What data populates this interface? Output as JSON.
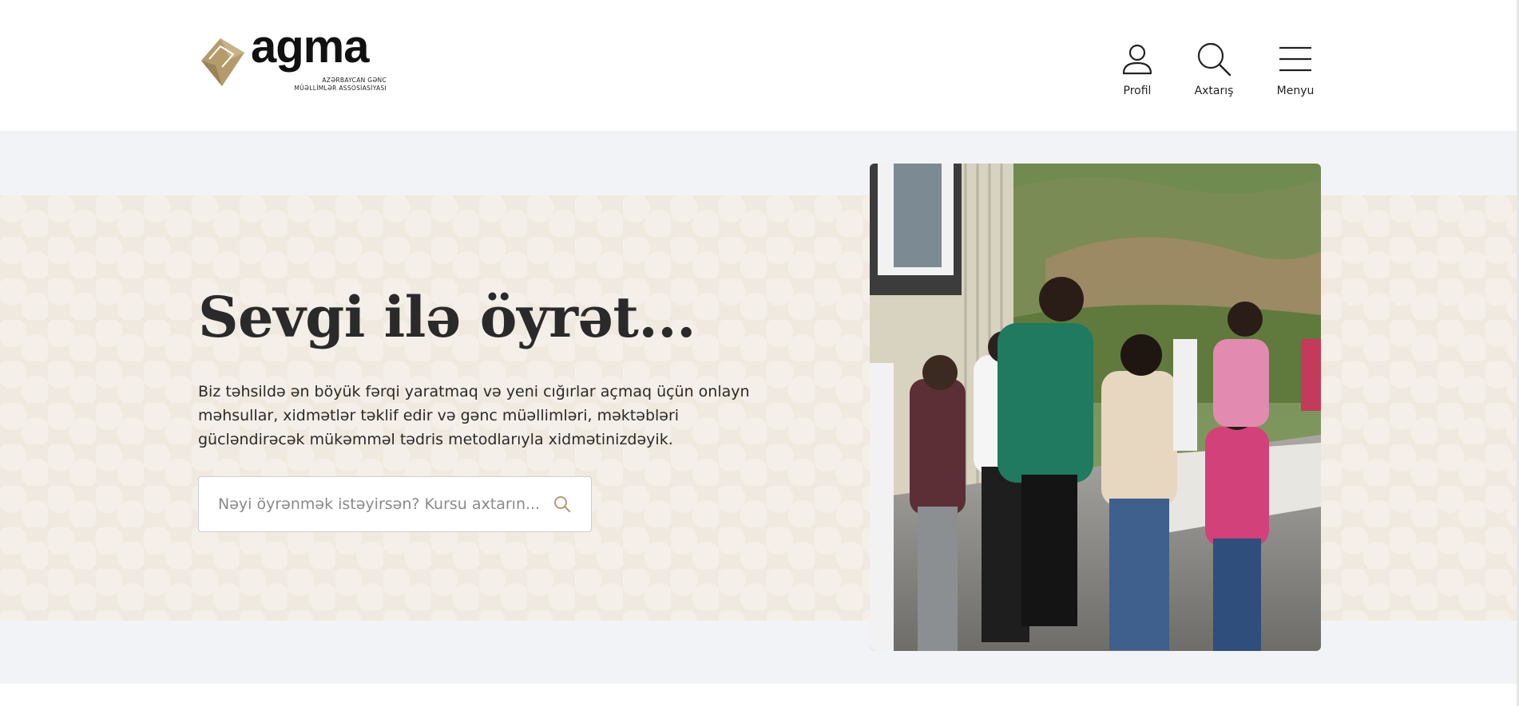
{
  "brand": {
    "logo_word": "agma",
    "logo_sub1": "AZƏRBAYCAN GƏNC",
    "logo_sub2": "MÜƏLLİMLƏR ASSOSİASİYASI",
    "accent": "#b59b6c"
  },
  "nav": {
    "profile": {
      "label": "Profil",
      "icon": "user-icon"
    },
    "search": {
      "label": "Axtarış",
      "icon": "search-icon"
    },
    "menu": {
      "label": "Menyu",
      "icon": "hamburger-icon"
    }
  },
  "hero": {
    "title": "Sevgi ilə öyrət...",
    "description": "Biz təhsildə ən böyük fərqi yaratmaq və yeni cığırlar açmaq üçün onlayn məhsullar, xidmətlər təklif edir və gənc müəllimləri, məktəbləri gücləndirəcək mükəmməl tədris metodlarıyla xidmətinizdəyik.",
    "search_placeholder": "Nəyi öyrənmək istəyirsən? Kursu axtarın...",
    "search_value": ""
  },
  "colors": {
    "hero_band": "#f2f3f6",
    "hero_pattern": "#f0e9df",
    "text": "#2a2a2a"
  }
}
